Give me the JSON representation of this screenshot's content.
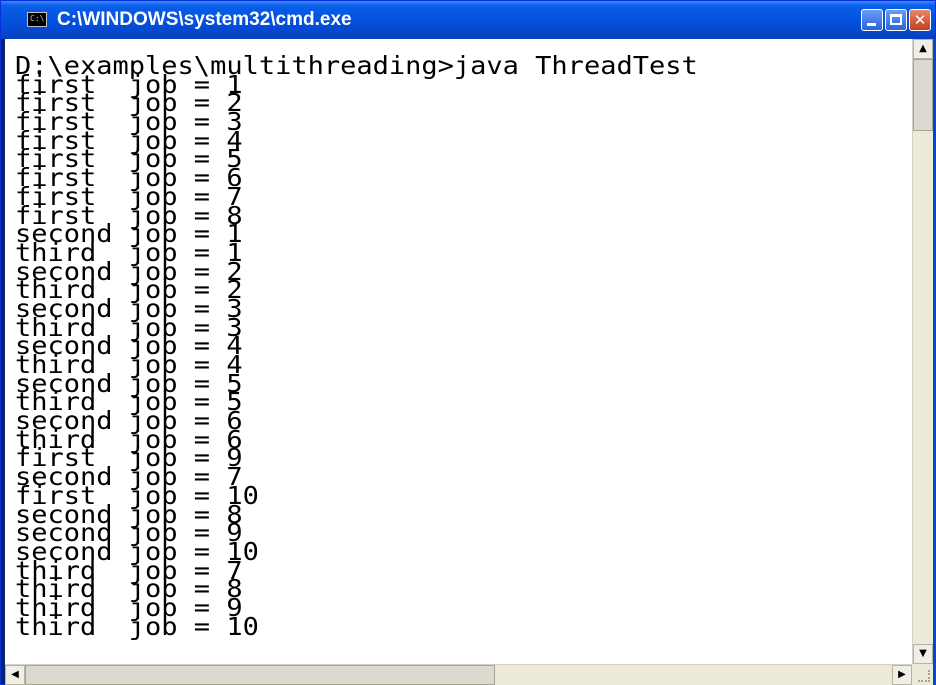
{
  "window": {
    "title": "C:\\WINDOWS\\system32\\cmd.exe",
    "icon": "cmd-icon",
    "icon_glyph": "C:\\",
    "controls": {
      "minimize_icon": "minimize-icon",
      "maximize_icon": "maximize-icon",
      "close_icon": "close-icon",
      "close_glyph": "✕"
    }
  },
  "console": {
    "lines": [
      "D:\\examples\\multithreading>java ThreadTest",
      "first  job = 1",
      "first  job = 2",
      "first  job = 3",
      "first  job = 4",
      "first  job = 5",
      "first  job = 6",
      "first  job = 7",
      "first  job = 8",
      "second job = 1",
      "third  job = 1",
      "second job = 2",
      "third  job = 2",
      "second job = 3",
      "third  job = 3",
      "second job = 4",
      "third  job = 4",
      "second job = 5",
      "third  job = 5",
      "second job = 6",
      "third  job = 6",
      "first  job = 9",
      "second job = 7",
      "first  job = 10",
      "second job = 8",
      "second job = 9",
      "second job = 10",
      "third  job = 7",
      "third  job = 8",
      "third  job = 9",
      "third  job = 10"
    ]
  },
  "scrollbars": {
    "up_glyph": "▲",
    "down_glyph": "▼",
    "left_glyph": "◀",
    "right_glyph": "▶"
  },
  "colors": {
    "titlebar": "#0553df",
    "console_bg": "#ffffff",
    "console_fg": "#000000"
  }
}
